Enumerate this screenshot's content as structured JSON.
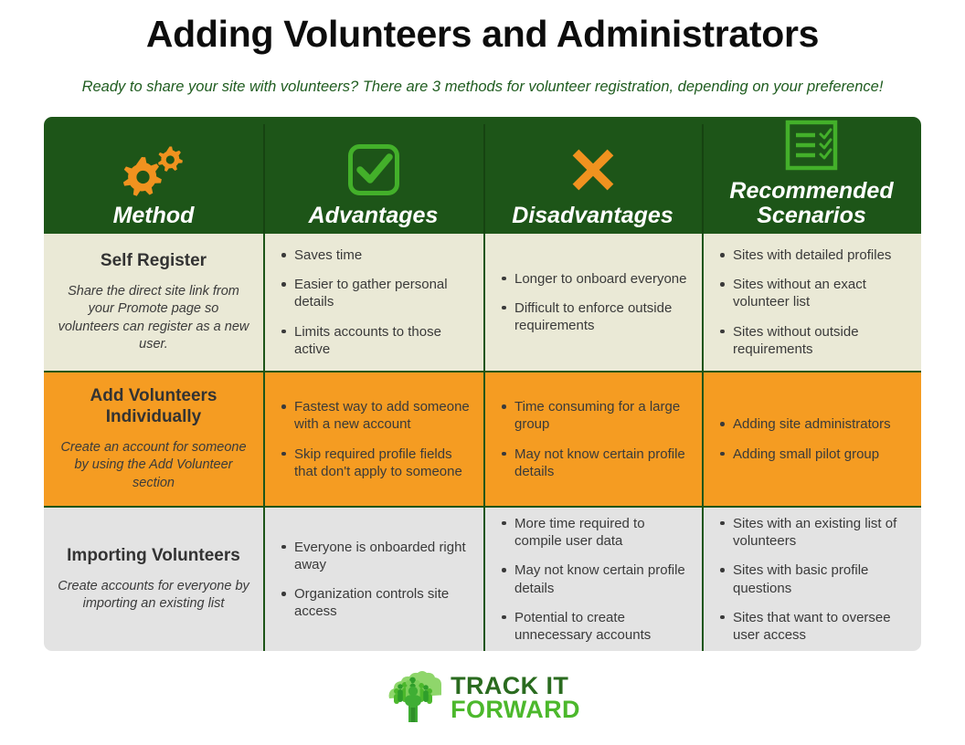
{
  "header": {
    "title": "Adding Volunteers and Administrators",
    "subtitle": "Ready to share your site with volunteers? There are 3 methods for volunteer registration, depending on your preference!"
  },
  "colors": {
    "header_green": "#1d5518",
    "divider_green": "#1d5518",
    "subtitle_green": "#1f5c1f",
    "orange_accent": "#f59c22",
    "row_beige": "#eae9d6",
    "row_orange": "#f59c22",
    "row_grey": "#e3e3e3",
    "check_green": "#43b02a",
    "logo_dark_green": "#2a6b1f",
    "logo_light_green": "#4cb82c",
    "text_dark": "#3a3a3a",
    "page_background": "#ffffff"
  },
  "table": {
    "columns": [
      {
        "label": "Method",
        "icon": "gears-icon"
      },
      {
        "label": "Advantages",
        "icon": "checkbox-check-icon"
      },
      {
        "label": "Disadvantages",
        "icon": "x-cross-icon"
      },
      {
        "label": "Recommended Scenarios",
        "icon": "checklist-icon"
      }
    ],
    "rows": [
      {
        "style": "beige",
        "method_title": "Self Register",
        "method_desc": "Share the direct site link from your Promote page so volunteers can register as a new user.",
        "advantages": [
          "Saves time",
          "Easier to gather personal details",
          "Limits accounts to those active"
        ],
        "disadvantages": [
          "Longer to onboard everyone",
          "Difficult to enforce outside requirements"
        ],
        "scenarios": [
          "Sites with detailed profiles",
          "Sites without an exact volunteer list",
          "Sites without outside requirements"
        ]
      },
      {
        "style": "orange",
        "method_title": "Add Volunteers Individually",
        "method_desc": "Create an account for someone by using the Add Volunteer section",
        "advantages": [
          "Fastest way to add someone with a new account",
          "Skip required profile fields that don't apply to someone"
        ],
        "disadvantages": [
          "Time consuming for a large group",
          "May not know certain profile details"
        ],
        "scenarios": [
          "Adding site administrators",
          "Adding small pilot group"
        ]
      },
      {
        "style": "grey",
        "method_title": "Importing Volunteers",
        "method_desc": "Create accounts for everyone by importing an existing list",
        "advantages": [
          "Everyone is onboarded right away",
          "Organization controls site access"
        ],
        "disadvantages": [
          "More time required to compile user data",
          "May not know certain profile details",
          "Potential to create unnecessary accounts"
        ],
        "scenarios": [
          "Sites with an existing list of volunteers",
          "Sites with basic profile questions",
          "Sites that want to oversee user access"
        ]
      }
    ]
  },
  "footer": {
    "logo_line1": "TRACK IT",
    "logo_line2": "FORWARD",
    "logo_icon": "tree-of-people-icon"
  }
}
